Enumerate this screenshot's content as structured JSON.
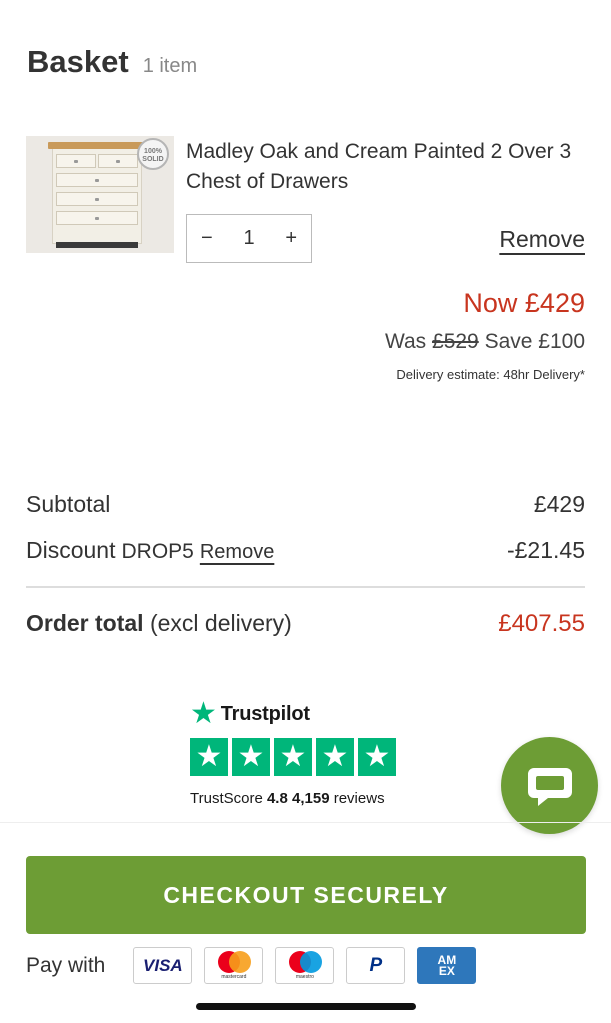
{
  "header": {
    "title": "Basket",
    "item_count": "1 item"
  },
  "item": {
    "badge_text": "100% SOLID",
    "name": "Madley Oak and Cream Painted 2 Over 3 Chest of Drawers",
    "quantity": "1",
    "decrement_symbol": "−",
    "increment_symbol": "+",
    "remove_label": "Remove",
    "now_price": "Now £429",
    "was_label": "Was",
    "was_price": "£529",
    "save_text": "Save £100",
    "delivery_estimate": "Delivery estimate: 48hr Delivery*"
  },
  "summary": {
    "subtotal_label": "Subtotal",
    "subtotal_value": "£429",
    "discount_label": "Discount",
    "discount_code": "DROP5",
    "discount_remove": "Remove",
    "discount_value": "-£21.45",
    "total_label_bold": "Order total",
    "total_label_note": "(excl delivery)",
    "total_value": "£407.55"
  },
  "trustpilot": {
    "brand": "Trustpilot",
    "stars": 5,
    "score_label": "TrustScore",
    "score": "4.8",
    "reviews": "4,159",
    "reviews_label": "reviews"
  },
  "checkout": {
    "label": "CHECKOUT SECURELY"
  },
  "payment": {
    "label": "Pay with",
    "methods": [
      "VISA",
      "mastercard",
      "maestro",
      "PayPal",
      "AMEX"
    ],
    "visa_text": "VISA",
    "mastercard_text": "mastercard",
    "maestro_text": "maestro",
    "paypal_text": "P",
    "amex_line1": "AM",
    "amex_line2": "EX"
  },
  "colors": {
    "accent_green": "#6d9d35",
    "sale_red": "#c8351f",
    "trustpilot_green": "#00b67a"
  },
  "icons": [
    "trustpilot-star-icon",
    "chat-bubble-icon"
  ]
}
